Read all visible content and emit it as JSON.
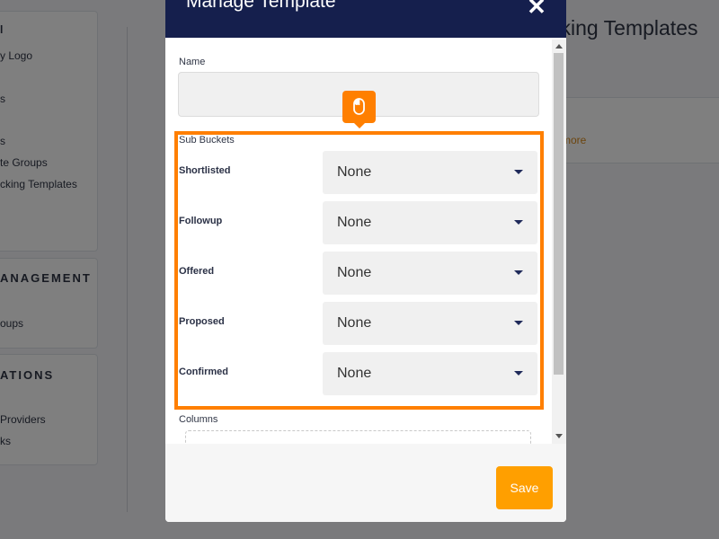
{
  "background": {
    "sidebar_card1": [
      "l",
      "y Logo",
      "s",
      "s",
      "te Groups",
      "cking Templates"
    ],
    "sidebar_card2": {
      "heading": "ANAGEMENT",
      "items": [
        "oups"
      ]
    },
    "sidebar_card3": {
      "heading": "ATIONS",
      "items": [
        "Providers",
        "ks"
      ]
    },
    "page_title": "cking Templates",
    "more_link": "more"
  },
  "modal": {
    "title": "Manage Template",
    "close_icon": "✕",
    "name_label": "Name",
    "name_value": "",
    "sub_buckets_label": "Sub Buckets",
    "buckets": [
      {
        "label": "Shortlisted",
        "value": "None"
      },
      {
        "label": "Followup",
        "value": "None"
      },
      {
        "label": "Offered",
        "value": "None"
      },
      {
        "label": "Proposed",
        "value": "None"
      },
      {
        "label": "Confirmed",
        "value": "None"
      }
    ],
    "columns_label": "Columns",
    "save_label": "Save"
  },
  "colors": {
    "header": "#151f4d",
    "accent": "#ff9f00",
    "highlight": "#ff7f00"
  }
}
